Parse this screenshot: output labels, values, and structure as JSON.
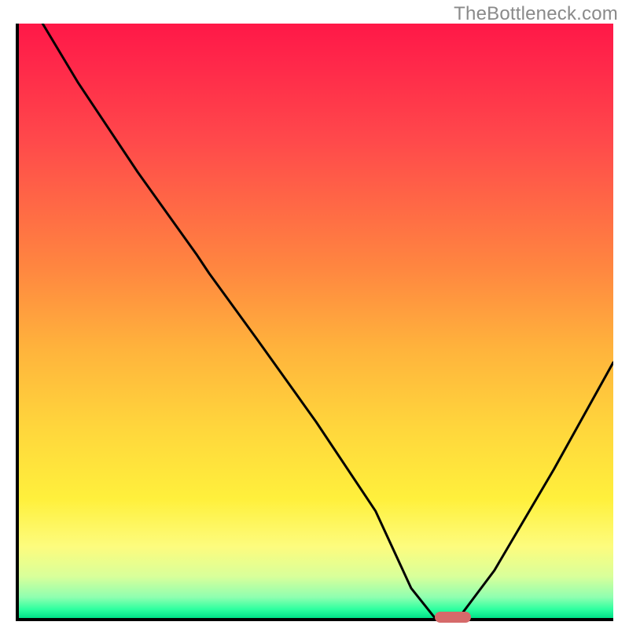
{
  "watermark": "TheBottleneck.com",
  "chart_data": {
    "type": "line",
    "title": "",
    "xlabel": "",
    "ylabel": "",
    "xlim": [
      0,
      100
    ],
    "ylim": [
      0,
      100
    ],
    "grid": false,
    "legend": false,
    "series": [
      {
        "name": "bottleneck-curve",
        "x": [
          4,
          10,
          20,
          30,
          32,
          40,
          50,
          60,
          66,
          70,
          74,
          80,
          90,
          100
        ],
        "y": [
          100,
          90,
          75,
          61,
          58,
          47,
          33,
          18,
          5,
          0,
          0,
          8,
          25,
          43
        ]
      }
    ],
    "annotations": [
      {
        "type": "marker",
        "name": "optimum-marker",
        "x_start": 70,
        "x_end": 76,
        "y": 0,
        "color": "#d66a6a"
      }
    ],
    "background_gradient": {
      "top": "#ff1848",
      "mid": "#ffd63c",
      "bottom": "#00e088"
    }
  }
}
